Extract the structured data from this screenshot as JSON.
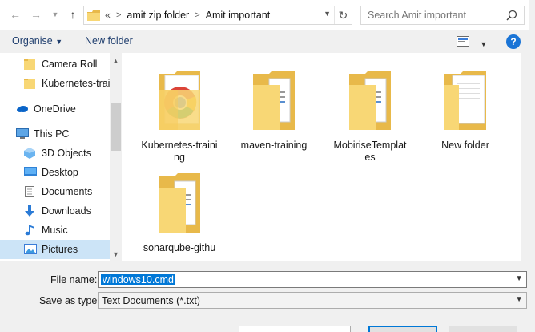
{
  "address": {
    "overflow_glyph": "«",
    "crumbs": [
      "amit zip folder",
      "Amit important"
    ]
  },
  "search": {
    "placeholder": "Search Amit important"
  },
  "toolbar": {
    "organise_label": "Organise",
    "new_folder_label": "New folder",
    "help_label": "?"
  },
  "sidebar": {
    "items": [
      {
        "label": "Camera Roll",
        "icon": "folder-icon"
      },
      {
        "label": "Kubernetes-train",
        "icon": "folder-icon"
      },
      {
        "label": "OneDrive",
        "icon": "cloud-icon"
      },
      {
        "label": "This PC",
        "icon": "computer-icon"
      },
      {
        "label": "3D Objects",
        "icon": "cube-icon"
      },
      {
        "label": "Desktop",
        "icon": "desktop-icon"
      },
      {
        "label": "Documents",
        "icon": "document-icon"
      },
      {
        "label": "Downloads",
        "icon": "download-arrow-icon"
      },
      {
        "label": "Music",
        "icon": "music-note-icon"
      },
      {
        "label": "Pictures",
        "icon": "picture-icon",
        "selected": true
      }
    ]
  },
  "files": [
    {
      "label": "Kubernetes-training",
      "type": "chrome-folder-icon"
    },
    {
      "label": "maven-training",
      "type": "folder-with-docs-icon"
    },
    {
      "label": "MobiriseTemplates",
      "type": "folder-with-docs-icon"
    },
    {
      "label": "New folder",
      "type": "folder-with-paper-icon"
    },
    {
      "label": "sonarqube-githu",
      "type": "folder-with-docs-icon"
    }
  ],
  "form": {
    "file_name_label": "File name:",
    "file_name_value": "windows10.cmd",
    "save_type_label": "Save as type:",
    "save_type_value": "Text Documents (*.txt)"
  },
  "colors": {
    "accent": "#0078d7",
    "selected_bg": "#cce4f7",
    "folder": "#f8d775"
  }
}
